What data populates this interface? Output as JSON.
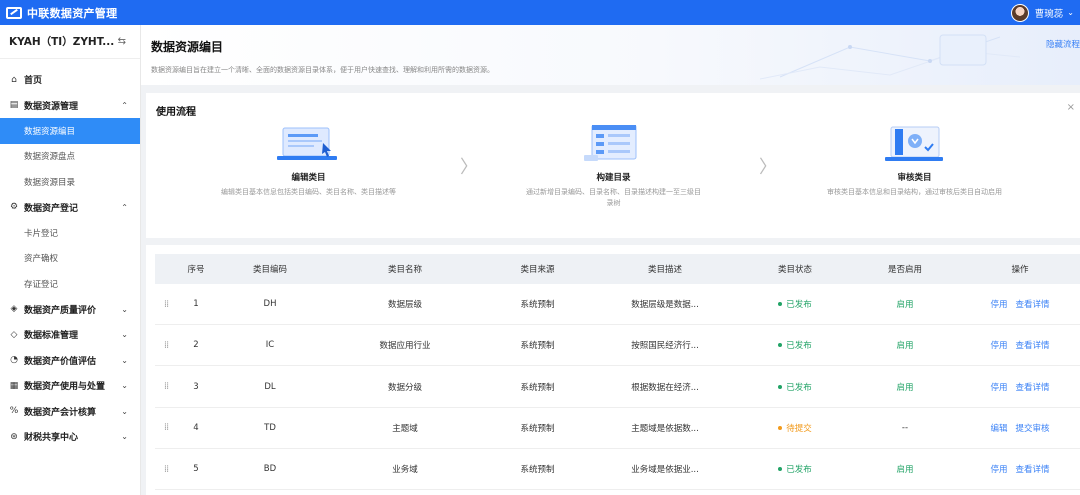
{
  "app": {
    "title": "中联数据资产管理"
  },
  "user": {
    "name": "曹琬蕊"
  },
  "sidebar": {
    "org": "KYAH（TI）ZYHT...",
    "items": [
      {
        "label": "首页",
        "icon": "home-icon"
      },
      {
        "label": "数据资源管理",
        "icon": "database-icon",
        "expanded": true,
        "children": [
          "数据资源编目",
          "数据资源盘点",
          "数据资源目录"
        ]
      },
      {
        "label": "数据资产登记",
        "icon": "register-icon",
        "expanded": true,
        "children": [
          "卡片登记",
          "资产确权",
          "存证登记"
        ]
      },
      {
        "label": "数据资产质量评价",
        "icon": "shield-icon"
      },
      {
        "label": "数据标准管理",
        "icon": "standard-icon"
      },
      {
        "label": "数据资产价值评估",
        "icon": "clock-icon"
      },
      {
        "label": "数据资产使用与处置",
        "icon": "grid-icon"
      },
      {
        "label": "数据资产会计核算",
        "icon": "percent-icon"
      },
      {
        "label": "财税共享中心",
        "icon": "share-icon"
      }
    ],
    "active": "数据资源编目"
  },
  "hero": {
    "title": "数据资源编目",
    "desc": "数据资源编目旨在建立一个清晰、全面的数据资源目录体系，便于用户快速查找、理解和利用所需的数据资源。",
    "hide_link": "隐藏流程"
  },
  "flow": {
    "title": "使用流程",
    "close": "×",
    "steps": [
      {
        "title": "编辑类目",
        "desc": "编辑类目基本信息包括类目编码、类目名称、类目描述等"
      },
      {
        "title": "构建目录",
        "desc": "通过新增目录编码、目录名称、目录描述构建一至三级目录树"
      },
      {
        "title": "审核类目",
        "desc": "审核类目基本信息和目录结构，通过审核后类目自动启用"
      }
    ]
  },
  "table": {
    "headers": [
      "序号",
      "类目编码",
      "类目名称",
      "类目来源",
      "类目描述",
      "类目状态",
      "是否启用",
      "操作"
    ],
    "rows": [
      {
        "no": "1",
        "code": "DH",
        "name": "数据层级",
        "source": "系统预制",
        "desc": "数据层级是数据...",
        "status": "已发布",
        "status_color": "#21a366",
        "enabled": "启用",
        "actions": [
          "停用",
          "查看详情"
        ]
      },
      {
        "no": "2",
        "code": "IC",
        "name": "数据应用行业",
        "source": "系统预制",
        "desc": "按照国民经济行...",
        "status": "已发布",
        "status_color": "#21a366",
        "enabled": "启用",
        "actions": [
          "停用",
          "查看详情"
        ]
      },
      {
        "no": "3",
        "code": "DL",
        "name": "数据分级",
        "source": "系统预制",
        "desc": "根据数据在经济...",
        "status": "已发布",
        "status_color": "#21a366",
        "enabled": "启用",
        "actions": [
          "停用",
          "查看详情"
        ]
      },
      {
        "no": "4",
        "code": "TD",
        "name": "主题域",
        "source": "系统预制",
        "desc": "主题域是依据数...",
        "status": "待提交",
        "status_color": "#f29a1b",
        "enabled": "--",
        "actions": [
          "编辑",
          "提交审核"
        ]
      },
      {
        "no": "5",
        "code": "BD",
        "name": "业务域",
        "source": "系统预制",
        "desc": "业务域是依据业...",
        "status": "已发布",
        "status_color": "#21a366",
        "enabled": "启用",
        "actions": [
          "停用",
          "查看详情"
        ]
      }
    ]
  }
}
